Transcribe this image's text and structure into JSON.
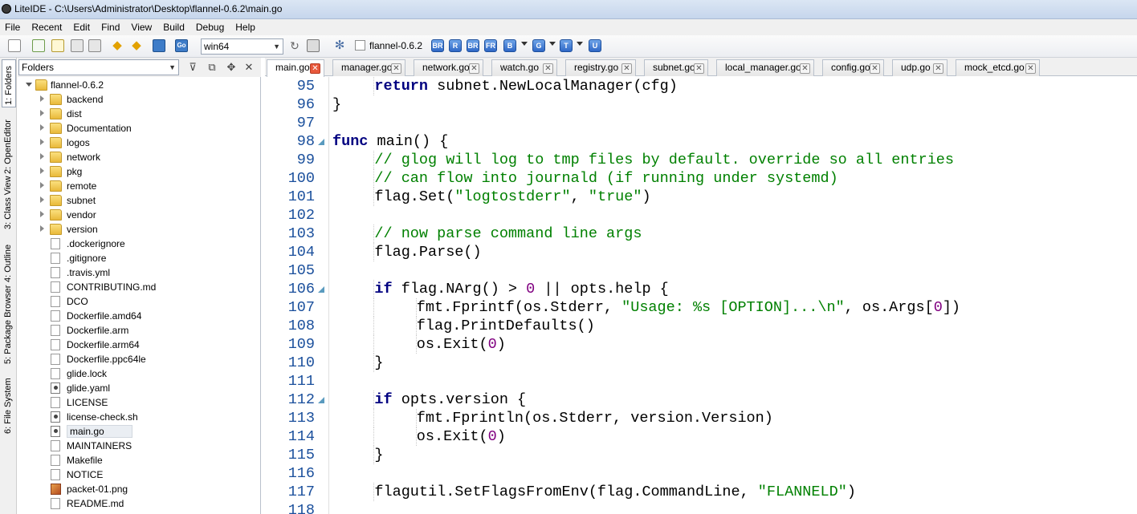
{
  "title": "LiteIDE - C:\\Users\\Administrator\\Desktop\\flannel-0.6.2\\main.go",
  "menu": [
    "File",
    "Recent",
    "Edit",
    "Find",
    "View",
    "Build",
    "Debug",
    "Help"
  ],
  "toolbar": {
    "env_select": "win64",
    "project_label": "flannel-0.6.2",
    "buttons": [
      "BR",
      "R",
      "BR",
      "FR",
      "B",
      "G",
      "T",
      "U"
    ]
  },
  "side_tabs": [
    "1: Folders",
    "2: OpenEditor",
    "3: Class View",
    "4: Outline",
    "5: Package Browser",
    "6: File System"
  ],
  "panel": {
    "select": "Folders",
    "tree": [
      {
        "name": "flannel-0.6.2",
        "type": "folder",
        "depth": 0,
        "expanded": true
      },
      {
        "name": "backend",
        "type": "folder",
        "depth": 1
      },
      {
        "name": "dist",
        "type": "folder",
        "depth": 1
      },
      {
        "name": "Documentation",
        "type": "folder",
        "depth": 1
      },
      {
        "name": "logos",
        "type": "folder",
        "depth": 1
      },
      {
        "name": "network",
        "type": "folder",
        "depth": 1
      },
      {
        "name": "pkg",
        "type": "folder",
        "depth": 1
      },
      {
        "name": "remote",
        "type": "folder",
        "depth": 1
      },
      {
        "name": "subnet",
        "type": "folder",
        "depth": 1
      },
      {
        "name": "vendor",
        "type": "folder",
        "depth": 1
      },
      {
        "name": "version",
        "type": "folder",
        "depth": 1
      },
      {
        "name": ".dockerignore",
        "type": "file",
        "depth": 1
      },
      {
        "name": ".gitignore",
        "type": "file",
        "depth": 1
      },
      {
        "name": ".travis.yml",
        "type": "file",
        "depth": 1
      },
      {
        "name": "CONTRIBUTING.md",
        "type": "file",
        "depth": 1
      },
      {
        "name": "DCO",
        "type": "file",
        "depth": 1
      },
      {
        "name": "Dockerfile.amd64",
        "type": "file",
        "depth": 1
      },
      {
        "name": "Dockerfile.arm",
        "type": "file",
        "depth": 1
      },
      {
        "name": "Dockerfile.arm64",
        "type": "file",
        "depth": 1
      },
      {
        "name": "Dockerfile.ppc64le",
        "type": "file",
        "depth": 1
      },
      {
        "name": "glide.lock",
        "type": "file",
        "depth": 1
      },
      {
        "name": "glide.yaml",
        "type": "gear",
        "depth": 1
      },
      {
        "name": "LICENSE",
        "type": "file",
        "depth": 1
      },
      {
        "name": "license-check.sh",
        "type": "gear",
        "depth": 1
      },
      {
        "name": "main.go",
        "type": "gear",
        "depth": 1,
        "selected": true
      },
      {
        "name": "MAINTAINERS",
        "type": "file",
        "depth": 1
      },
      {
        "name": "Makefile",
        "type": "file",
        "depth": 1
      },
      {
        "name": "NOTICE",
        "type": "file",
        "depth": 1
      },
      {
        "name": "packet-01.png",
        "type": "img",
        "depth": 1
      },
      {
        "name": "README.md",
        "type": "file",
        "depth": 1
      }
    ]
  },
  "tabs": [
    {
      "label": "main.go",
      "active": true
    },
    {
      "label": "manager.go"
    },
    {
      "label": "network.go"
    },
    {
      "label": "watch.go"
    },
    {
      "label": "registry.go"
    },
    {
      "label": "subnet.go"
    },
    {
      "label": "local_manager.go"
    },
    {
      "label": "config.go"
    },
    {
      "label": "udp.go"
    },
    {
      "label": "mock_etcd.go"
    }
  ],
  "code": [
    {
      "n": "95",
      "t": "\treturn subnet.NewLocalManager(cfg)"
    },
    {
      "n": "96",
      "t": "}"
    },
    {
      "n": "97",
      "t": ""
    },
    {
      "n": "98",
      "t": "func main() {",
      "fold": true
    },
    {
      "n": "99",
      "t": "\t// glog will log to tmp files by default. override so all entries"
    },
    {
      "n": "100",
      "t": "\t// can flow into journald (if running under systemd)"
    },
    {
      "n": "101",
      "t": "\tflag.Set(\"logtostderr\", \"true\")"
    },
    {
      "n": "102",
      "t": ""
    },
    {
      "n": "103",
      "t": "\t// now parse command line args"
    },
    {
      "n": "104",
      "t": "\tflag.Parse()"
    },
    {
      "n": "105",
      "t": ""
    },
    {
      "n": "106",
      "t": "\tif flag.NArg() > 0 || opts.help {",
      "fold": true
    },
    {
      "n": "107",
      "t": "\t\tfmt.Fprintf(os.Stderr, \"Usage: %s [OPTION]...\\n\", os.Args[0])"
    },
    {
      "n": "108",
      "t": "\t\tflag.PrintDefaults()"
    },
    {
      "n": "109",
      "t": "\t\tos.Exit(0)"
    },
    {
      "n": "110",
      "t": "\t}"
    },
    {
      "n": "111",
      "t": ""
    },
    {
      "n": "112",
      "t": "\tif opts.version {",
      "fold": true
    },
    {
      "n": "113",
      "t": "\t\tfmt.Fprintln(os.Stderr, version.Version)"
    },
    {
      "n": "114",
      "t": "\t\tos.Exit(0)"
    },
    {
      "n": "115",
      "t": "\t}"
    },
    {
      "n": "116",
      "t": ""
    },
    {
      "n": "117",
      "t": "\tflagutil.SetFlagsFromEnv(flag.CommandLine, \"FLANNELD\")"
    },
    {
      "n": "118",
      "t": ""
    }
  ],
  "colors": {
    "keyword": "#000080",
    "comment": "#008000",
    "string": "#008000",
    "number": "#800080",
    "line_number": "#1a4f9c",
    "close_active": "#e8583b"
  }
}
